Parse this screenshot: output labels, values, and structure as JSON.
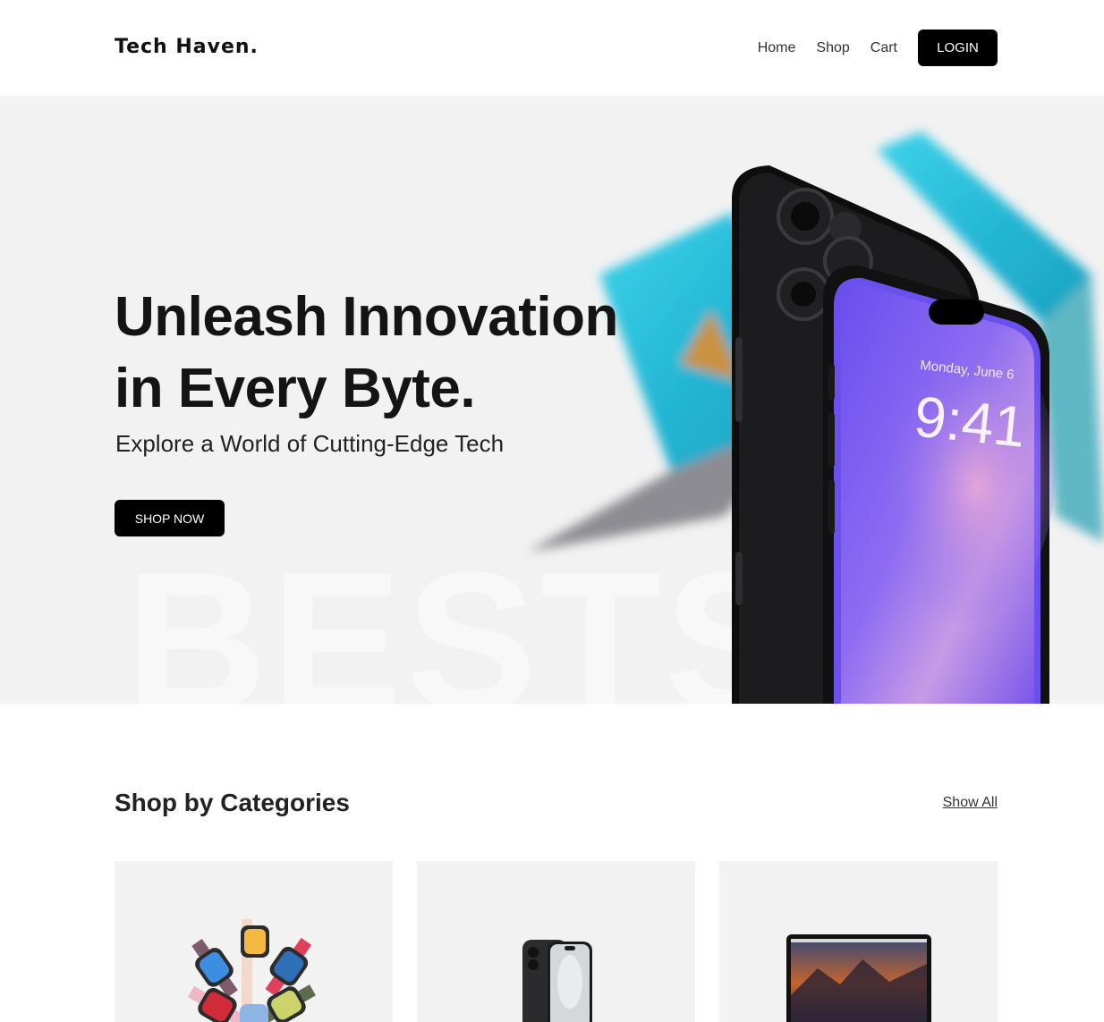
{
  "header": {
    "logo": "Tech Haven.",
    "nav": [
      "Home",
      "Shop",
      "Cart"
    ],
    "login_label": "LOGIN"
  },
  "hero": {
    "title_line1": "Unleash Innovation",
    "title_line2": "in Every Byte.",
    "subtitle": "Explore a World of Cutting-Edge Tech",
    "cta_label": "SHOP NOW",
    "background_word": "BESTS",
    "phone_date": "Monday, June 6",
    "phone_time": "9:41"
  },
  "categories": {
    "title": "Shop by Categories",
    "show_all_label": "Show All",
    "items": [
      {
        "icon": "smartwatch-icon"
      },
      {
        "icon": "smartphone-icon"
      },
      {
        "icon": "laptop-icon"
      }
    ]
  },
  "colors": {
    "primary": "#000000",
    "hero_bg": "#f2f2f2",
    "card_bg": "#f2f2f2",
    "screen_purple": "#7b5cf0"
  }
}
